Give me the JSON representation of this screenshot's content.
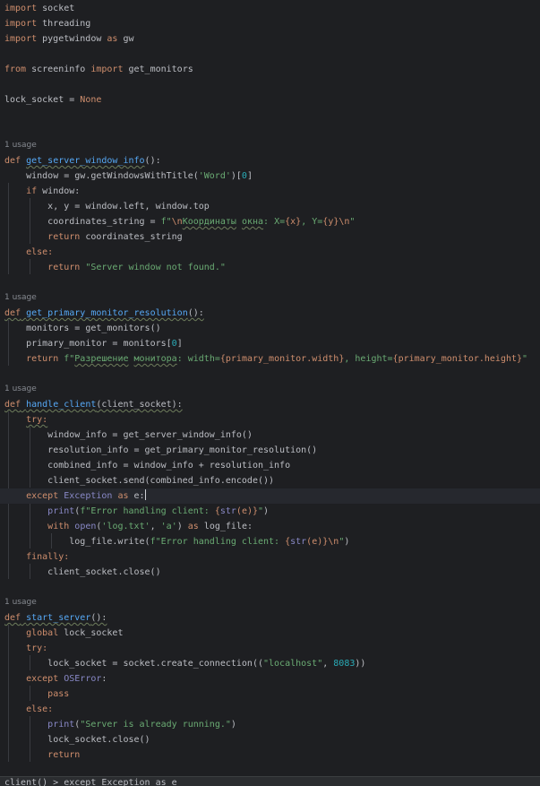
{
  "editor": {
    "accent_colors": {
      "keyword": "#cf8e6d",
      "function": "#56a8f5",
      "string": "#6aab73",
      "number": "#2aacb8",
      "builtin": "#8888c6",
      "text": "#bcbec4",
      "background": "#1e1f22"
    },
    "inlay": {
      "usage": "1 usage"
    },
    "tokens": {
      "kw_import": "import",
      "kw_from": "from",
      "kw_as": "as",
      "kw_def": "def",
      "kw_if": "if",
      "kw_else": "else:",
      "kw_return": "return",
      "kw_try": "try:",
      "kw_except": "except",
      "kw_finally": "finally:",
      "kw_with": "with",
      "kw_global": "global",
      "kw_pass": "pass",
      "kw_none": "None",
      "bi_print": "print",
      "bi_str": "str",
      "bi_open": "open",
      "cls_exception": "Exception",
      "cls_oserror": "OSError"
    },
    "lines": {
      "l1_mod": " socket",
      "l2_mod": " threading",
      "l3_mod": " pygetwindow ",
      "l3_alias": " gw",
      "l5_mod": " screeninfo ",
      "l5_name": " get_monitors",
      "l7_pre": "lock_socket = ",
      "f1_name": "get_server_window_info",
      "f1_tail": "():",
      "f1_a": "window = gw.getWindowsWithTitle(",
      "f1_a_str": "'Word'",
      "f1_a_close": ")[",
      "f1_a_num": "0",
      "f1_a_end": "]",
      "f1_b": " window:",
      "f1_c": "x, y = window.left, window.top",
      "f1_d": "coordinates_string = ",
      "f1_d_s1": "f\"",
      "f1_d_esc1": "\\n",
      "f1_d_ru1": "Координаты",
      "f1_d_sp": " ",
      "f1_d_ru2": "окна",
      "f1_d_s2": ": X=",
      "f1_d_x": "{x}",
      "f1_d_s3": ", Y=",
      "f1_d_y": "{y}",
      "f1_d_esc2": "\\n",
      "f1_d_s4": "\"",
      "f1_e": " coordinates_string",
      "f1_g": "\"Server window not found.\"",
      "f2_name": "get_primary_monitor_resolution",
      "f2_tail": "():",
      "f2_a": "monitors = get_monitors()",
      "f2_b": "primary_monitor = monitors[",
      "f2_b_num": "0",
      "f2_b_end": "]",
      "f2_c_s1": " f\"",
      "f2_c_ru1": "Разрешение",
      "f2_c_sp": " ",
      "f2_c_ru2": "монитора",
      "f2_c_s2": ": width=",
      "f2_c_w": "{primary_monitor.width}",
      "f2_c_s3": ", height=",
      "f2_c_h": "{primary_monitor.height}",
      "f2_c_s4": "\"",
      "f3_name": "handle_client",
      "f3_tail": "(client_socket):",
      "f3_a": "window_info = get_server_window_info()",
      "f3_b": "resolution_info = get_primary_monitor_resolution()",
      "f3_c": "combined_info = window_info + resolution_info",
      "f3_d": "client_socket.send(combined_info.encode())",
      "f3_e_end": " e:",
      "f3_f_open": "(",
      "f3_f_s1": "f\"Error handling client: ",
      "f3_f_b1": "{",
      "f3_f_b2": "(e)}",
      "f3_f_s2": "\"",
      "f3_f_close": ")",
      "f3_g_open": " ",
      "f3_g_paren": "(",
      "f3_g_s1": "'log.txt'",
      "f3_g_comma": ", ",
      "f3_g_s2": "'a'",
      "f3_g_close": ") ",
      "f3_g_end": " log_file:",
      "f3_h": "log_file.write(",
      "f3_h_s1": "f\"Error handling client: ",
      "f3_h_b1": "{",
      "f3_h_b2": "(e)}",
      "f3_h_esc": "\\n",
      "f3_h_s2": "\"",
      "f3_h_close": ")",
      "f3_j": "client_socket.close()",
      "f4_name": "start_server",
      "f4_tail": "():",
      "f4_a": " lock_socket",
      "f4_c": "lock_socket = socket.create_connection((",
      "f4_c_str": "\"localhost\"",
      "f4_c_comma": ", ",
      "f4_c_num": "8083",
      "f4_c_end": "))",
      "f4_f_open": "(",
      "f4_f_str": "\"Server is already running.\"",
      "f4_f_close": ")",
      "f4_g": "lock_socket.close()"
    }
  },
  "status_bar": {
    "text": "client() > except Exception as e"
  }
}
